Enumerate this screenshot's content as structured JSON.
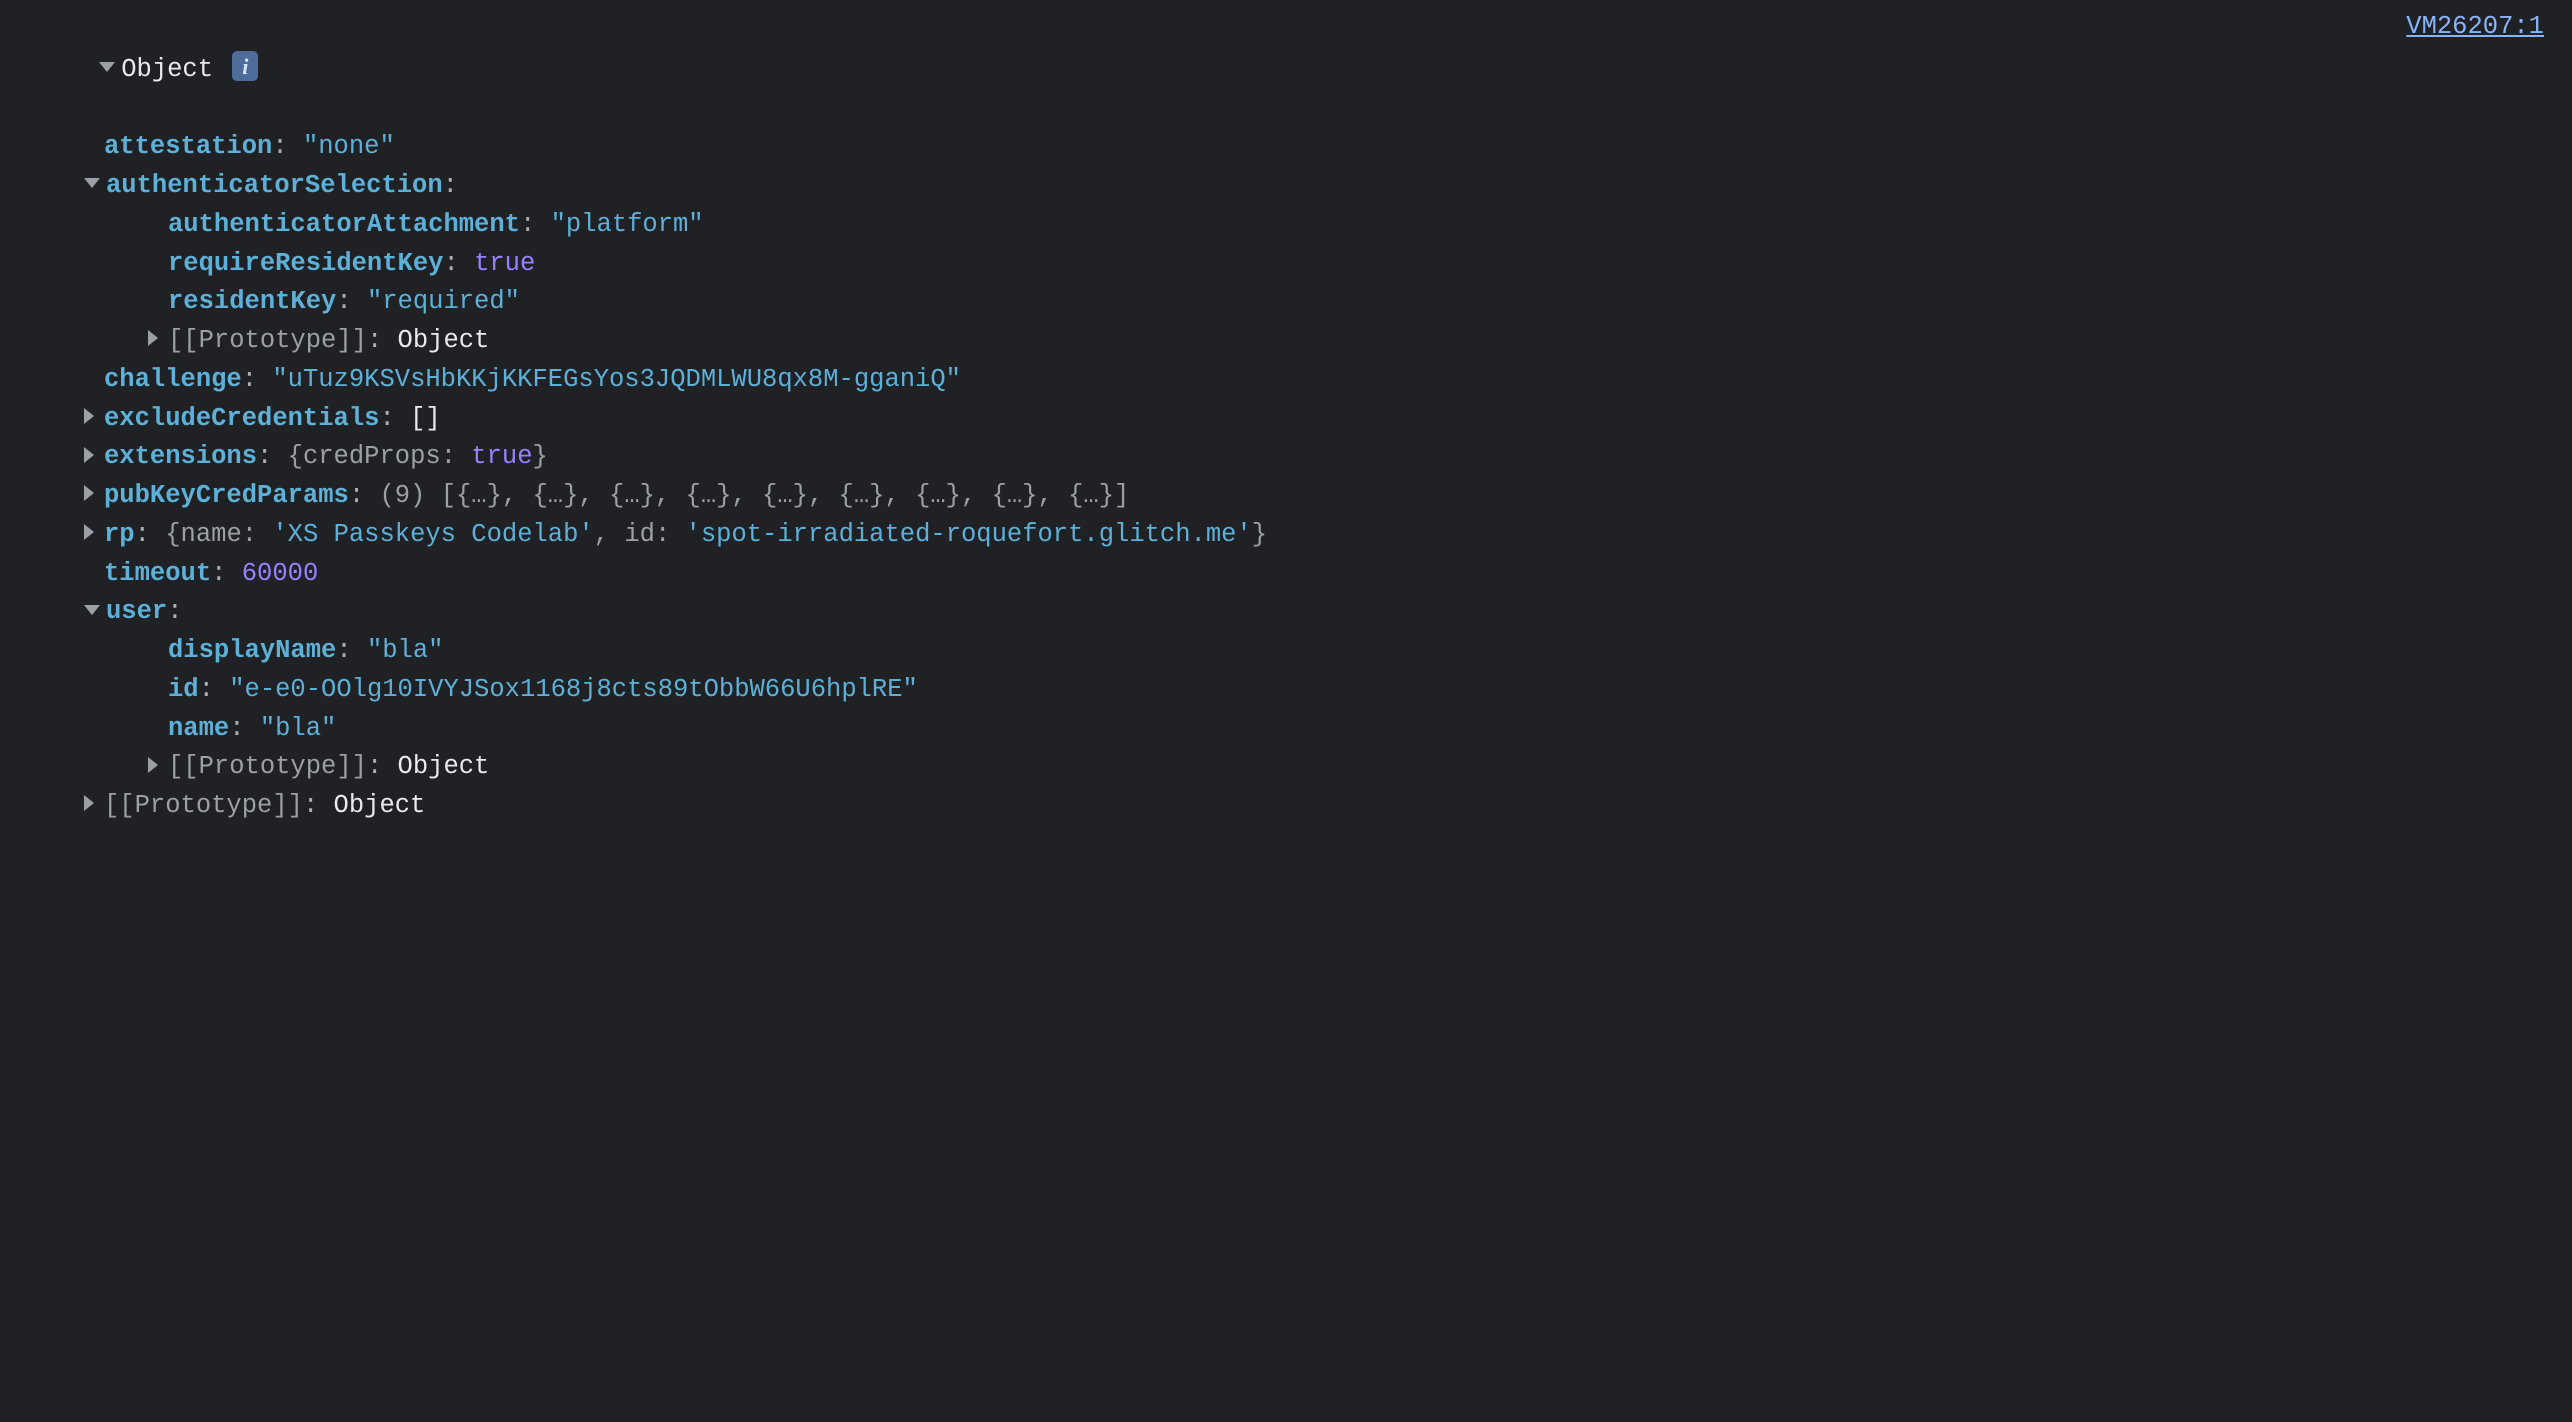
{
  "sourceLink": "VM26207:1",
  "rootLabel": "Object",
  "infoBadge": "i",
  "props": {
    "attestation": {
      "key": "attestation",
      "value": "\"none\""
    },
    "authenticatorSelection": {
      "key": "authenticatorSelection",
      "children": {
        "authenticatorAttachment": {
          "key": "authenticatorAttachment",
          "value": "\"platform\""
        },
        "requireResidentKey": {
          "key": "requireResidentKey",
          "value": "true"
        },
        "residentKey": {
          "key": "residentKey",
          "value": "\"required\""
        },
        "prototype": {
          "key": "[[Prototype]]",
          "value": "Object"
        }
      }
    },
    "challenge": {
      "key": "challenge",
      "value": "\"uTuz9KSVsHbKKjKKFEGsYos3JQDMLWU8qx8M-gganiQ\""
    },
    "excludeCredentials": {
      "key": "excludeCredentials",
      "value": "[]"
    },
    "extensions": {
      "key": "extensions",
      "preview": {
        "open": "{",
        "k1": "credProps",
        "sep": ": ",
        "v1": "true",
        "close": "}"
      }
    },
    "pubKeyCredParams": {
      "key": "pubKeyCredParams",
      "count": "(9)",
      "preview": "[{…}, {…}, {…}, {…}, {…}, {…}, {…}, {…}, {…}]"
    },
    "rp": {
      "key": "rp",
      "preview": {
        "open": "{",
        "k1": "name",
        "v1": "'XS Passkeys Codelab'",
        "sep1": ": ",
        "comma": ", ",
        "k2": "id",
        "v2": "'spot-irradiated-roquefort.glitch.me'",
        "sep2": ": ",
        "close": "}"
      }
    },
    "timeout": {
      "key": "timeout",
      "value": "60000"
    },
    "user": {
      "key": "user",
      "children": {
        "displayName": {
          "key": "displayName",
          "value": "\"bla\""
        },
        "id": {
          "key": "id",
          "value": "\"e-e0-OOlg10IVYJSox1168j8cts89tObbW66U6hplRE\""
        },
        "name": {
          "key": "name",
          "value": "\"bla\""
        },
        "prototype": {
          "key": "[[Prototype]]",
          "value": "Object"
        }
      }
    },
    "prototype": {
      "key": "[[Prototype]]",
      "value": "Object"
    }
  }
}
